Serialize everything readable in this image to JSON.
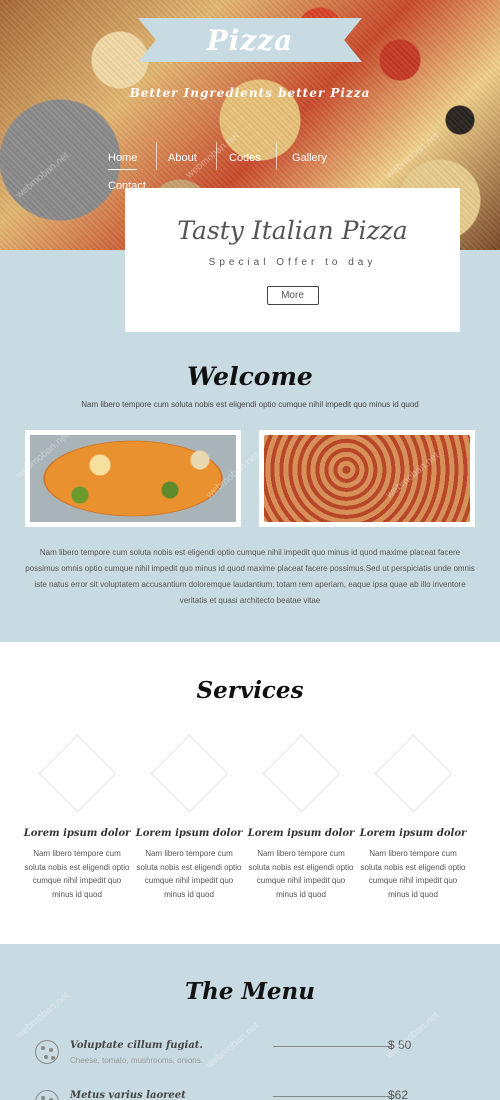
{
  "header": {
    "logo": "Pizza",
    "tagline": "Better Ingredients better Pizza",
    "nav": [
      {
        "label": "Home",
        "active": true
      },
      {
        "label": "About"
      },
      {
        "label": "Codes"
      },
      {
        "label": "Gallery"
      },
      {
        "label": "Contact"
      }
    ]
  },
  "offer": {
    "title": "Tasty Italian Pizza",
    "subtitle": "Special Offer to day",
    "button": "More"
  },
  "welcome": {
    "title": "Welcome",
    "lead": "Nam libero tempore cum soluta nobis est eligendi optio cumque nihil impedit quo minus id quod",
    "text": "Nam libero tempore cum soluta nobis est eligendi optio cumque nihil impedit quo minus id quod maxime placeat facere possimus omnis optio cumque nihil impedit quo minus id quod maxime placeat facere possimus.Sed ut perspiciatis unde omnis iste natus error sit voluptatem accusantium doloremque laudantium, totam rem aperiam, eaque ipsa quae ab illo inventore veritatis et quasi architecto beatae vitae"
  },
  "services": {
    "title": "Services",
    "items": [
      {
        "title": "Lorem ipsum dolor",
        "text": "Nam libero tempore cum soluta nobis est eligendi optio cumque nihil impedit quo minus id quod"
      },
      {
        "title": "Lorem ipsum dolor",
        "text": "Nam libero tempore cum soluta nobis est eligendi optio cumque nihil impedit quo minus id quod"
      },
      {
        "title": "Lorem ipsum dolor",
        "text": "Nam libero tempore cum soluta nobis est eligendi optio cumque nihil impedit quo minus id quod"
      },
      {
        "title": "Lorem ipsum dolor",
        "text": "Nam libero tempore cum soluta nobis est eligendi optio cumque nihil impedit quo minus id quod"
      }
    ]
  },
  "menu": {
    "title": "The Menu",
    "items": [
      {
        "name": "Voluptate cillum fugiat.",
        "desc": "Cheese, tomato, mushrooms, onions.",
        "price": "$ 50",
        "icon": "pizza-icon"
      },
      {
        "name": "Metus varius laoreet",
        "desc": "",
        "price": "$62",
        "icon": "pizza-icon"
      }
    ]
  },
  "watermark": "webmoban.net",
  "colors": {
    "background": "#c9dbe2",
    "card": "#ffffff",
    "title": "#111111"
  }
}
